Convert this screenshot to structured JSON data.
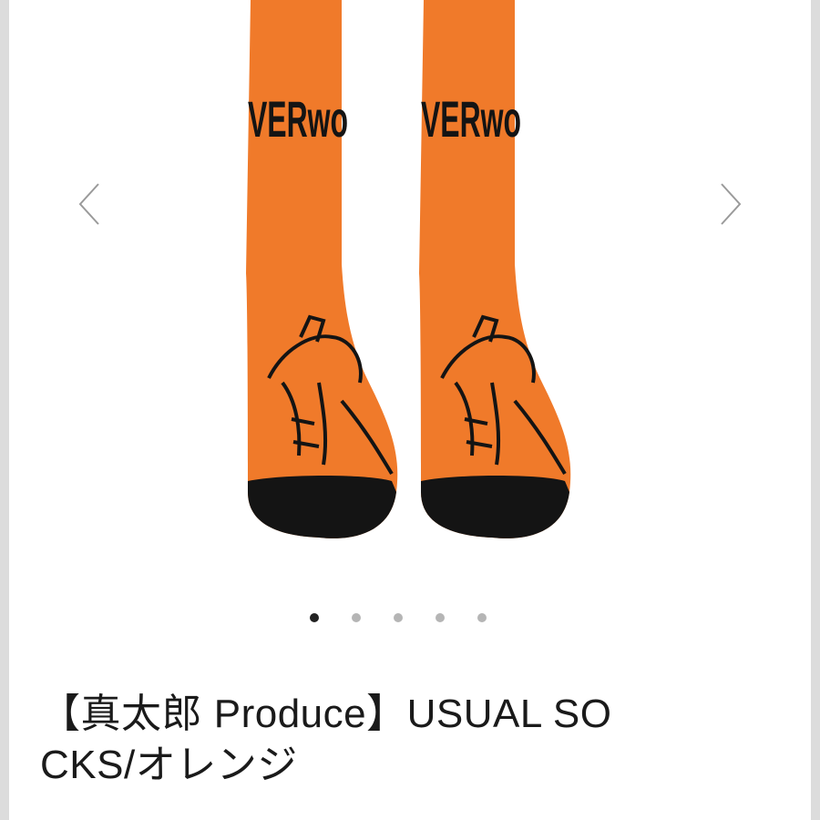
{
  "product": {
    "title_line1": "【真太郎 Produce】USUAL SO",
    "title_line2": "CKS/オレンジ",
    "sock_text": "VERwo",
    "sock_color": "#f07a2a",
    "toe_color": "#141414"
  },
  "carousel": {
    "prev_icon": "chevron-left-icon",
    "next_icon": "chevron-right-icon",
    "slide_count": 5,
    "active_slide": 1
  }
}
